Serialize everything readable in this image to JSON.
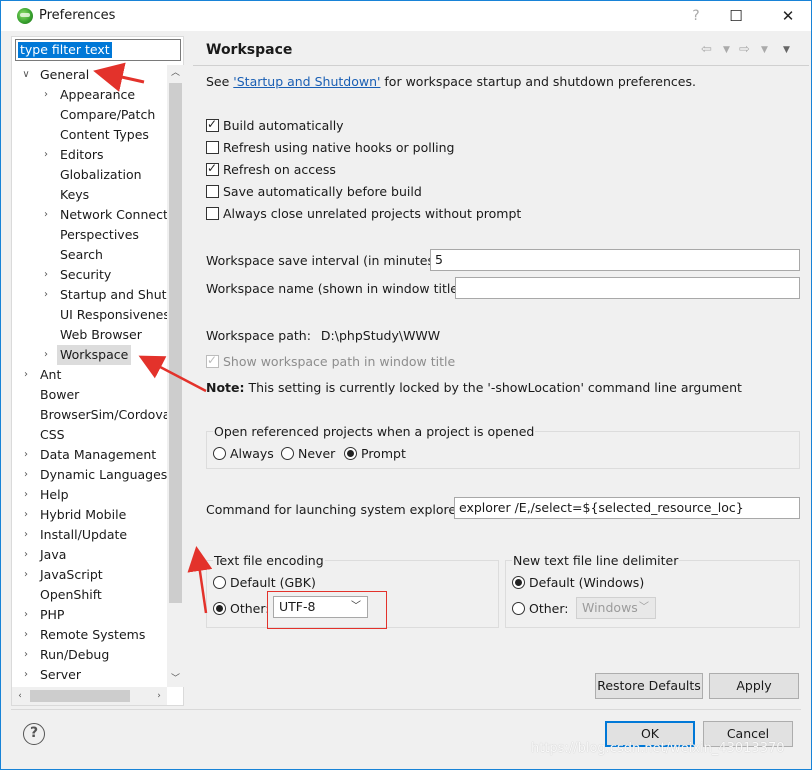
{
  "window": {
    "title": "Preferences",
    "help_symbol": "?",
    "minimize_symbol": "—",
    "maximize_symbol": "☐",
    "close_symbol": "✕"
  },
  "sidebar": {
    "filter_text": "type filter text",
    "items": [
      {
        "label": "General",
        "arrow": "expanded",
        "level": 0
      },
      {
        "label": "Appearance",
        "arrow": "collapsed",
        "level": 1
      },
      {
        "label": "Compare/Patch",
        "arrow": "none",
        "level": 1
      },
      {
        "label": "Content Types",
        "arrow": "none",
        "level": 1
      },
      {
        "label": "Editors",
        "arrow": "collapsed",
        "level": 1
      },
      {
        "label": "Globalization",
        "arrow": "none",
        "level": 1
      },
      {
        "label": "Keys",
        "arrow": "none",
        "level": 1
      },
      {
        "label": "Network Connecti",
        "arrow": "collapsed",
        "level": 1
      },
      {
        "label": "Perspectives",
        "arrow": "none",
        "level": 1
      },
      {
        "label": "Search",
        "arrow": "none",
        "level": 1
      },
      {
        "label": "Security",
        "arrow": "collapsed",
        "level": 1
      },
      {
        "label": "Startup and Shutd",
        "arrow": "collapsed",
        "level": 1
      },
      {
        "label": "UI Responsivenes",
        "arrow": "none",
        "level": 1
      },
      {
        "label": "Web Browser",
        "arrow": "none",
        "level": 1
      },
      {
        "label": "Workspace",
        "arrow": "collapsed",
        "level": 1,
        "selected": true
      },
      {
        "label": "Ant",
        "arrow": "collapsed",
        "level": 0
      },
      {
        "label": "Bower",
        "arrow": "none",
        "level": 0
      },
      {
        "label": "BrowserSim/Cordova",
        "arrow": "none",
        "level": 0
      },
      {
        "label": "CSS",
        "arrow": "none",
        "level": 0
      },
      {
        "label": "Data Management",
        "arrow": "collapsed",
        "level": 0
      },
      {
        "label": "Dynamic Languages",
        "arrow": "collapsed",
        "level": 0
      },
      {
        "label": "Help",
        "arrow": "collapsed",
        "level": 0
      },
      {
        "label": "Hybrid Mobile",
        "arrow": "collapsed",
        "level": 0
      },
      {
        "label": "Install/Update",
        "arrow": "collapsed",
        "level": 0
      },
      {
        "label": "Java",
        "arrow": "collapsed",
        "level": 0
      },
      {
        "label": "JavaScript",
        "arrow": "collapsed",
        "level": 0
      },
      {
        "label": "OpenShift",
        "arrow": "none",
        "level": 0
      },
      {
        "label": "PHP",
        "arrow": "collapsed",
        "level": 0
      },
      {
        "label": "Remote Systems",
        "arrow": "collapsed",
        "level": 0
      },
      {
        "label": "Run/Debug",
        "arrow": "collapsed",
        "level": 0
      },
      {
        "label": "Server",
        "arrow": "collapsed",
        "level": 0
      }
    ]
  },
  "page": {
    "title": "Workspace",
    "see_prefix": "See ",
    "see_link": "'Startup and Shutdown'",
    "see_suffix": " for workspace startup and shutdown preferences.",
    "checkboxes": [
      {
        "label": "Build automatically",
        "checked": true
      },
      {
        "label": "Refresh using native hooks or polling",
        "checked": false
      },
      {
        "label": "Refresh on access",
        "checked": true
      },
      {
        "label": "Save automatically before build",
        "checked": false
      },
      {
        "label": "Always close unrelated projects without prompt",
        "checked": false
      }
    ],
    "save_interval_label": "Workspace save interval (in minutes):",
    "save_interval_value": "5",
    "workspace_name_label": "Workspace name (shown in window title):",
    "workspace_name_value": "",
    "workspace_path_label": "Workspace path:",
    "workspace_path_value": "D:\\phpStudy\\WWW",
    "show_path_label": "Show workspace path in window title",
    "note_bold": "Note:",
    "note_text": " This setting is currently locked by the '-showLocation' command line argument",
    "open_group_title": "Open referenced projects when a project is opened",
    "open_options": [
      {
        "label": "Always",
        "checked": false
      },
      {
        "label": "Never",
        "checked": false
      },
      {
        "label": "Prompt",
        "checked": true
      }
    ],
    "explorer_label": "Command for launching system explorer:",
    "explorer_value": "explorer /E,/select=${selected_resource_loc}",
    "encoding_group_title": "Text file encoding",
    "encoding_default_label": "Default (GBK)",
    "encoding_other_label": "Other:",
    "encoding_other_value": "UTF-8",
    "delimiter_group_title": "New text file line delimiter",
    "delimiter_default_label": "Default (Windows)",
    "delimiter_other_label": "Other:",
    "delimiter_other_value": "Windows",
    "restore_defaults_label": "Restore Defaults",
    "apply_label": "Apply"
  },
  "footer": {
    "ok_label": "OK",
    "cancel_label": "Cancel",
    "help_icon_symbol": "?"
  },
  "watermark": "https://blog.csdn.net/weixin_43013370",
  "annotation_color": "#e3322b",
  "accent_color": "#0078d7"
}
